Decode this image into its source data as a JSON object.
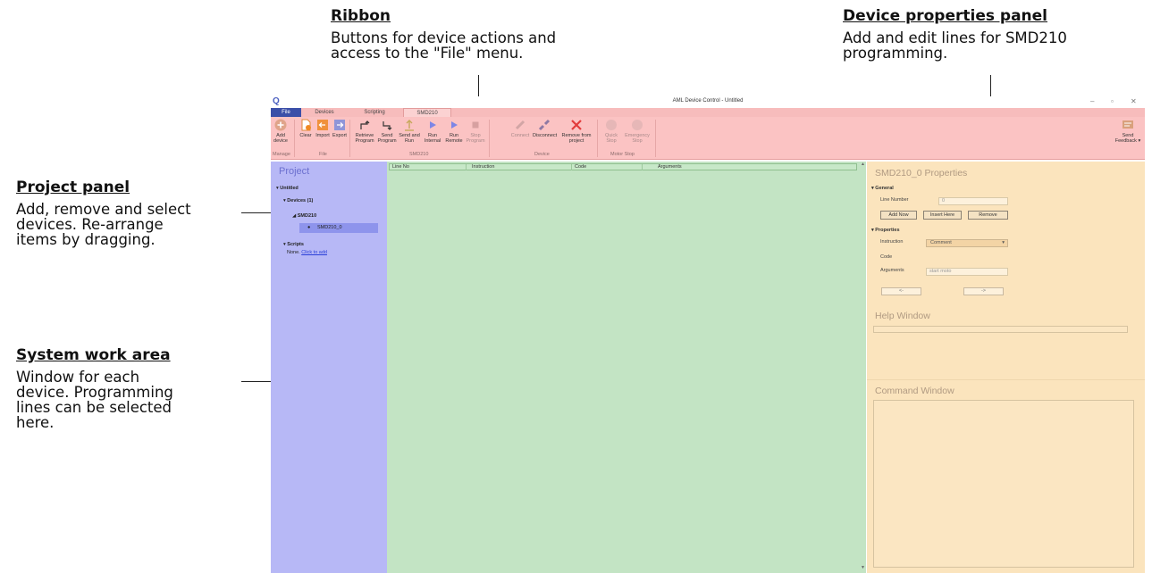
{
  "callouts": {
    "ribbon": {
      "title": "Ribbon",
      "desc": "Buttons for device actions and\naccess to the \"File\" menu."
    },
    "properties": {
      "title": "Device properties panel",
      "desc": "Add and edit lines for SMD210\nprogramming."
    },
    "project": {
      "title": "Project panel",
      "desc": "Add, remove and select\ndevices. Re-arrange\nitems by dragging."
    },
    "work": {
      "title": "System work area",
      "desc": "Window for each\ndevice. Programming\nlines can be selected\nhere."
    }
  },
  "window": {
    "title": "AML Device Control - Untitled",
    "minimize": "–",
    "restore": "▫",
    "close": "✕",
    "logo": "Q"
  },
  "tabs": [
    "File",
    "Devices",
    "Scripting",
    "SMD210"
  ],
  "ribbon": {
    "buttons": [
      {
        "label": "Add device",
        "icon": "add-circle-icon",
        "disabled": false
      },
      {
        "label": "Clear",
        "icon": "clear-doc-icon",
        "disabled": false
      },
      {
        "label": "Import",
        "icon": "import-icon",
        "disabled": false
      },
      {
        "label": "Export",
        "icon": "export-icon",
        "disabled": false
      },
      {
        "label": "Retrieve Program",
        "icon": "retrieve-icon",
        "disabled": false
      },
      {
        "label": "Send Program",
        "icon": "send-icon",
        "disabled": false
      },
      {
        "label": "Send and Run",
        "icon": "upload-icon",
        "disabled": false
      },
      {
        "label": "Run Internal",
        "icon": "play-icon",
        "disabled": false
      },
      {
        "label": "Run Remote",
        "icon": "play-icon",
        "disabled": false
      },
      {
        "label": "Stop Program",
        "icon": "stop-icon",
        "disabled": true
      },
      {
        "label": "Connect",
        "icon": "connect-icon",
        "disabled": true
      },
      {
        "label": "Disconnect",
        "icon": "disconnect-icon",
        "disabled": false
      },
      {
        "label": "Remove from project",
        "icon": "remove-x-icon",
        "disabled": false
      },
      {
        "label": "Quick Stop",
        "icon": "quick-stop-icon",
        "disabled": true
      },
      {
        "label": "Emergency Stop",
        "icon": "emergency-stop-icon",
        "disabled": true
      }
    ],
    "groups": [
      "Manage",
      "File",
      "SMD210",
      "Device",
      "Motor Stop"
    ],
    "feedback": "Send Feedback ▾"
  },
  "project": {
    "title": "Project",
    "root": "Untitled",
    "devices": "Devices (1)",
    "device_group": "SMD210",
    "device": "SMD210_0",
    "scripts": "Scripts",
    "scripts_none": "None.",
    "scripts_link": "Click to add"
  },
  "grid": {
    "columns": [
      "Line No",
      "Instruction",
      "Code",
      "Arguments"
    ]
  },
  "properties": {
    "title": "SMD210_0  Properties",
    "general": "General",
    "line_number_label": "Line Number",
    "line_number_value": "0",
    "add_now": "Add Now",
    "insert_here": "Insert Here",
    "remove": "Remove",
    "properties_section": "Properties",
    "instruction_label": "Instruction",
    "instruction_value": "Comment",
    "code_label": "Code",
    "arguments_label": "Arguments",
    "arguments_placeholder": "start moto",
    "prev": "<-",
    "next": "->",
    "help_window": "Help Window",
    "command_window": "Command Window"
  },
  "colors": {
    "ribbon": "#fbc3c3",
    "project_panel": "#b7b8f6",
    "work_area": "#c3e4c4",
    "properties_panel": "#fbe4bd",
    "file_tab": "#3b4fa8"
  }
}
